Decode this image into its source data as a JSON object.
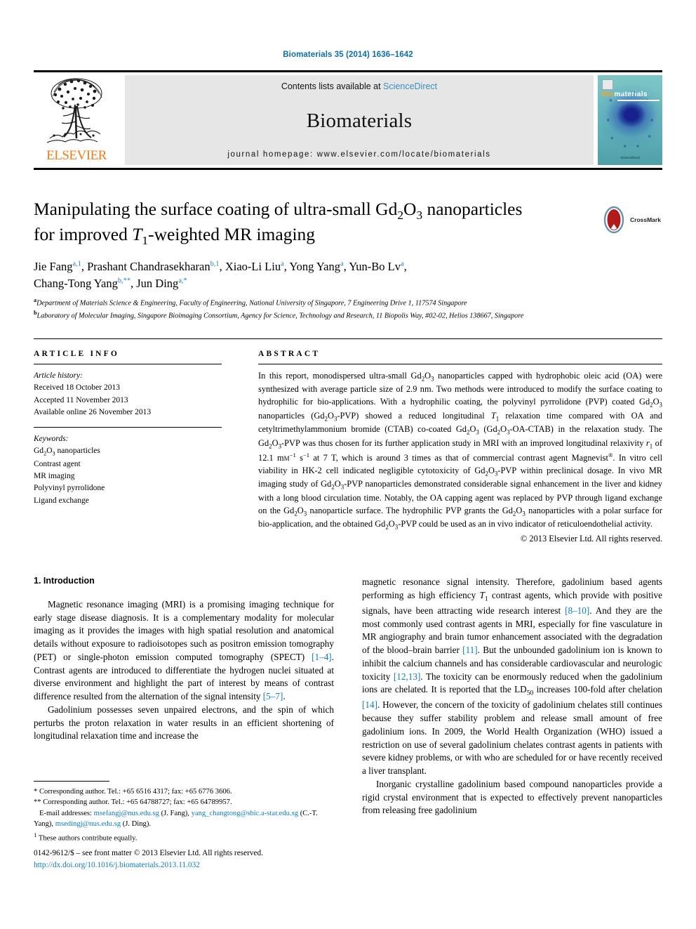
{
  "running_head": "Biomaterials 35 (2014) 1636–1642",
  "masthead": {
    "publisher_wordmark": "ELSEVIER",
    "contents_prefix": "Contents lists available at ",
    "contents_link": "ScienceDirect",
    "journal_name": "Biomaterials",
    "homepage_line": "journal homepage: www.elsevier.com/locate/biomaterials",
    "cover": {
      "title_first": "Bio",
      "title_rest": "materials",
      "footer_text": "ScienceDirect"
    }
  },
  "article": {
    "title_line1_a": "Manipulating the surface coating of ultra-small Gd",
    "title_sub1": "2",
    "title_line1_b": "O",
    "title_sub2": "3",
    "title_line1_c": " nanoparticles",
    "title_line2_a": "for improved ",
    "title_title_italic": "T",
    "title_sub3": "1",
    "title_line2_b": "-weighted MR imaging",
    "crossmark_label": "CrossMark",
    "authors": [
      {
        "name": "Jie Fang",
        "sup": "a,1"
      },
      {
        "name": "Prashant Chandrasekharan",
        "sup": "b,1"
      },
      {
        "name": "Xiao-Li Liu",
        "sup": "a"
      },
      {
        "name": "Yong Yang",
        "sup": "a"
      },
      {
        "name": "Yun-Bo Lv",
        "sup": "a"
      },
      {
        "name": "Chang-Tong Yang",
        "sup": "b,**"
      },
      {
        "name": "Jun Ding",
        "sup": "a,*"
      }
    ],
    "affiliations": [
      {
        "marker": "a",
        "text": "Department of Materials Science & Engineering, Faculty of Engineering, National University of Singapore, 7 Engineering Drive 1, 117574 Singapore"
      },
      {
        "marker": "b",
        "text": "Laboratory of Molecular Imaging, Singapore Bioimaging Consortium, Agency for Science, Technology and Research, 11 Biopolis Way, #02-02, Helios 138667, Singapore"
      }
    ]
  },
  "article_info": {
    "heading": "ARTICLE INFO",
    "history_label": "Article history:",
    "history": [
      "Received 18 October 2013",
      "Accepted 11 November 2013",
      "Available online 26 November 2013"
    ],
    "keywords_label": "Keywords:",
    "keywords": [
      "Gd2O3 nanoparticles",
      "Contrast agent",
      "MR imaging",
      "Polyvinyl pyrrolidone",
      "Ligand exchange"
    ]
  },
  "abstract": {
    "heading": "ABSTRACT",
    "text": "In this report, monodispersed ultra-small Gd2O3 nanoparticles capped with hydrophobic oleic acid (OA) were synthesized with average particle size of 2.9 nm. Two methods were introduced to modify the surface coating to hydrophilic for bio-applications. With a hydrophilic coating, the polyvinyl pyrrolidone (PVP) coated Gd2O3 nanoparticles (Gd2O3-PVP) showed a reduced longitudinal T1 relaxation time compared with OA and cetyltrimethylammonium bromide (CTAB) co-coated Gd2O3 (Gd2O3-OA-CTAB) in the relaxation study. The Gd2O3-PVP was thus chosen for its further application study in MRI with an improved longitudinal relaxivity r1 of 12.1 mM-1 s-1 at 7 T, which is around 3 times as that of commercial contrast agent Magnevist®. In vitro cell viability in HK-2 cell indicated negligible cytotoxicity of Gd2O3-PVP within preclinical dosage. In vivo MR imaging study of Gd2O3-PVP nanoparticles demonstrated considerable signal enhancement in the liver and kidney with a long blood circulation time. Notably, the OA capping agent was replaced by PVP through ligand exchange on the Gd2O3 nanoparticle surface. The hydrophilic PVP grants the Gd2O3 nanoparticles with a polar surface for bio-application, and the obtained Gd2O3-PVP could be used as an in vivo indicator of reticuloendothelial activity.",
    "copyright": "© 2013 Elsevier Ltd. All rights reserved."
  },
  "body": {
    "section_title": "1. Introduction",
    "left_paragraphs": [
      "Magnetic resonance imaging (MRI) is a promising imaging technique for early stage disease diagnosis. It is a complementary modality for molecular imaging as it provides the images with high spatial resolution and anatomical details without exposure to radioisotopes such as positron emission tomography (PET) or single-photon emission computed tomography (SPECT) [1–4]. Contrast agents are introduced to differentiate the hydrogen nuclei situated at diverse environment and highlight the part of interest by means of contrast difference resulted from the alternation of the signal intensity [5–7].",
      "Gadolinium possesses seven unpaired electrons, and the spin of which perturbs the proton relaxation in water results in an efficient shortening of longitudinal relaxation time and increase the"
    ],
    "right_paragraphs": [
      "magnetic resonance signal intensity. Therefore, gadolinium based agents performing as high efficiency T1 contrast agents, which provide with positive signals, have been attracting wide research interest [8–10]. And they are the most commonly used contrast agents in MRI, especially for fine vasculature in MR angiography and brain tumor enhancement associated with the degradation of the blood–brain barrier [11]. But the unbounded gadolinium ion is known to inhibit the calcium channels and has considerable cardiovascular and neurologic toxicity [12,13]. The toxicity can be enormously reduced when the gadolinium ions are chelated. It is reported that the LD50 increases 100-fold after chelation [14]. However, the concern of the toxicity of gadolinium chelates still continues because they suffer stability problem and release small amount of free gadolinium ions. In 2009, the World Health Organization (WHO) issued a restriction on use of several gadolinium chelates contrast agents in patients with severe kidney problems, or with who are scheduled for or have recently received a liver transplant.",
      "Inorganic crystalline gadolinium based compound nanoparticles provide a rigid crystal environment that is expected to effectively prevent nanoparticles from releasing free gadolinium"
    ]
  },
  "footnotes": {
    "corr1": "Corresponding author. Tel.: +65 6516 4317; fax: +65 6776 3606.",
    "corr1_marker": "*",
    "corr2": "Corresponding author. Tel.: +65 64788727; fax: +65 64789957.",
    "corr2_marker": "**",
    "email_label": "E-mail addresses:",
    "emails": [
      {
        "address": "msefangj@nus.edu.sg",
        "owner": "(J. Fang)"
      },
      {
        "address": "yang_changtong@sbic.a-star.edu.sg",
        "owner": "(C.-T. Yang)"
      },
      {
        "address": "msedingj@nus.edu.sg",
        "owner": "(J. Ding)"
      }
    ],
    "equal_marker": "1",
    "equal_contribution": "These authors contribute equally."
  },
  "imprint": {
    "issn_line": "0142-9612/$ – see front matter © 2013 Elsevier Ltd. All rights reserved.",
    "doi": "http://dx.doi.org/10.1016/j.biomaterials.2013.11.032"
  },
  "colors": {
    "link": "#0f7bbd",
    "running_head": "#0b6ea8",
    "elsevier_orange": "#f07c1a",
    "sciencedirect": "#3a8fc4"
  }
}
